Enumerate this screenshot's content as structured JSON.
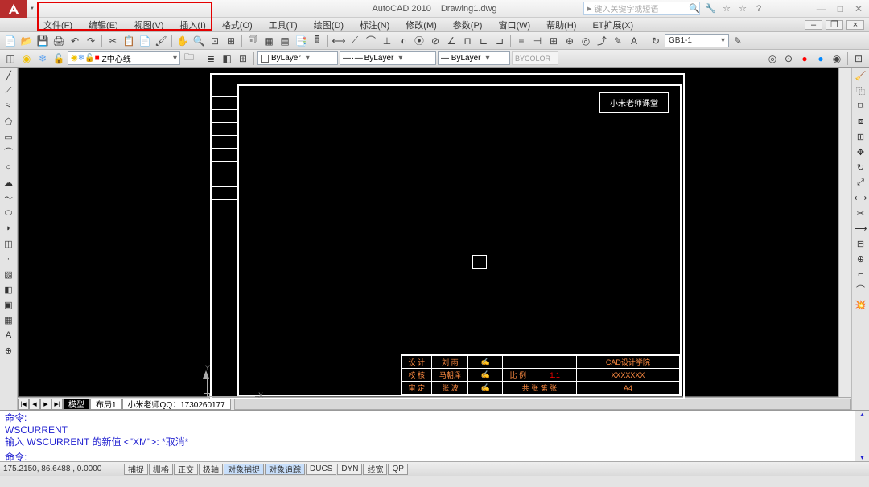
{
  "title": {
    "app": "AutoCAD 2010",
    "doc": "Drawing1.dwg"
  },
  "search_placeholder": "键入关键字或短语",
  "menu": [
    "文件(F)",
    "编辑(E)",
    "视图(V)",
    "插入(I)",
    "格式(O)",
    "工具(T)",
    "绘图(D)",
    "标注(N)",
    "修改(M)",
    "参数(P)",
    "窗口(W)",
    "帮助(H)",
    "ET扩展(X)"
  ],
  "layer": {
    "current": "Z中心线"
  },
  "props": {
    "color": "ByLayer",
    "linetype": "ByLayer",
    "lineweight": "ByLayer",
    "plotstyle": "BYCOLOR"
  },
  "dim_style": "GB1-1",
  "drawing": {
    "label": "小米老师课堂",
    "titleblock": {
      "r1": [
        "设 计",
        "刘 雨",
        "",
        "",
        "CAD设计学院"
      ],
      "r2": [
        "校 核",
        "马朝泽",
        "",
        "比 例",
        "1:1",
        "XXXXXXX"
      ],
      "r3": [
        "审 定",
        "张 波",
        "",
        "共   张  第   张",
        "A4"
      ]
    }
  },
  "tabs": [
    "模型",
    "布局1",
    "小米老师QQ：1730260177"
  ],
  "cmd": {
    "l1": "命令:",
    "l2": "WSCURRENT",
    "l3": "输入 WSCURRENT 的新值 <\"XM\">: *取消*",
    "l4": "命令:"
  },
  "status": {
    "coords": "175.2150,  86.6488 ,  0.0000",
    "toggles": [
      "捕捉",
      "栅格",
      "正交",
      "极轴",
      "对象捕捉",
      "对象追踪",
      "DUCS",
      "DYN",
      "线宽",
      "QP"
    ],
    "active": [
      4,
      5
    ]
  }
}
